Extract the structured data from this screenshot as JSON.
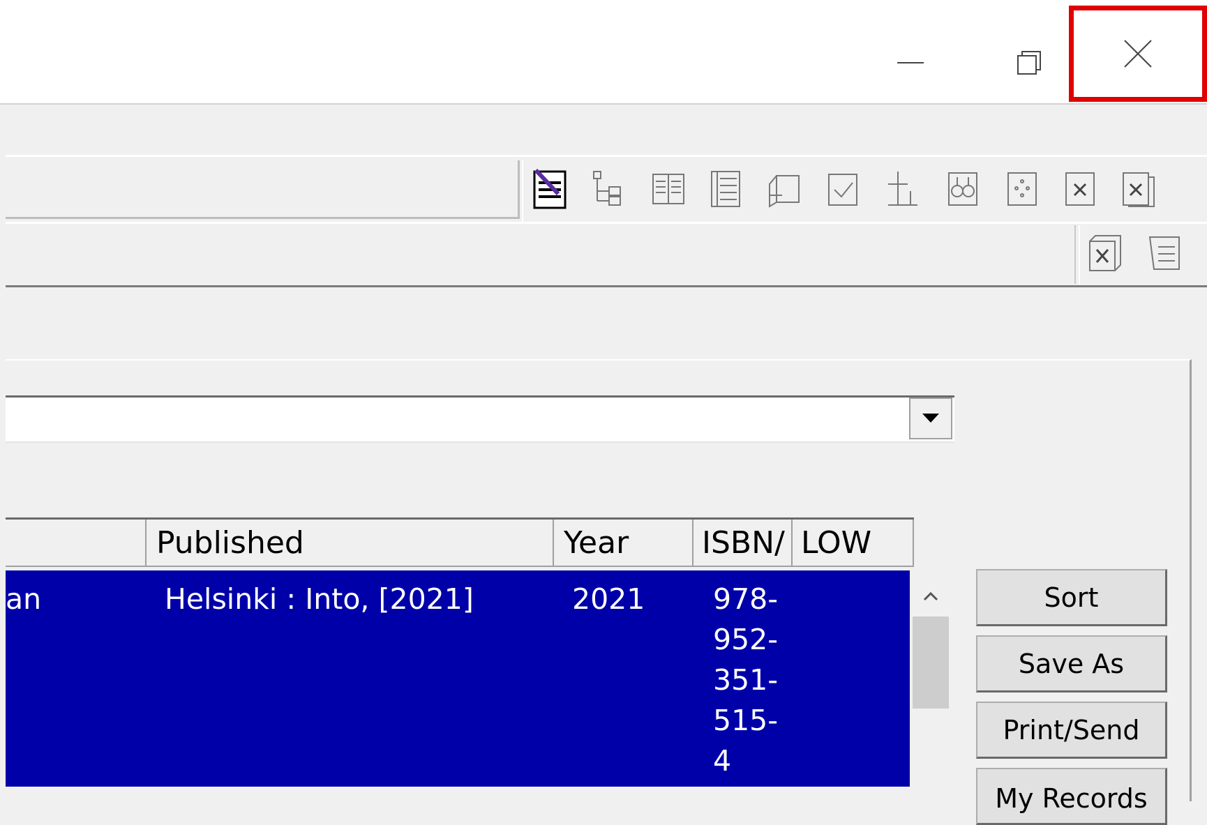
{
  "table": {
    "columns": [
      {
        "label": ""
      },
      {
        "label": "Published"
      },
      {
        "label": "Year"
      },
      {
        "label": "ISBN/"
      },
      {
        "label": "LOW"
      }
    ],
    "rows": [
      {
        "title_fragment": "an",
        "published": "Helsinki : Into, [2021]",
        "year": "2021",
        "isbn_lines": [
          "978-",
          "952-",
          "351-",
          "515-",
          "4"
        ],
        "low": ""
      }
    ]
  },
  "buttons": {
    "sort": "Sort",
    "save_as": "Save As",
    "print_send": "Print/Send",
    "my_records": "My Records"
  },
  "toolbar_icons": [
    "edit-record-icon",
    "tree-view-icon",
    "brief-view-icon",
    "full-view-icon",
    "export-icon",
    "check-icon",
    "split-icon",
    "search-binoculars-icon",
    "move-icon",
    "delete-icon",
    "delete-all-icon"
  ],
  "toolbar2_icons": [
    "close-record-icon",
    "list-record-icon"
  ],
  "colors": {
    "selection": "#0000a8",
    "close_highlight": "#e00000"
  }
}
